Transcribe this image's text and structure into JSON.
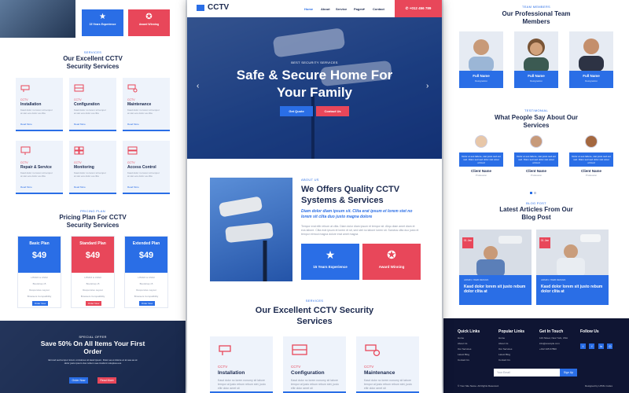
{
  "left": {
    "badges": [
      {
        "label": "15 Years Experience",
        "color": "#2a6ee6"
      },
      {
        "label": "Award Winning",
        "color": "#e8475a"
      }
    ],
    "services_kicker": "SERVICES",
    "services_title": "Our Excellent CCTV Security Services",
    "services": [
      {
        "kicker": "CCTV",
        "title": "Installation",
        "desc": "Kasd dolor no lorem sit tempor at stet eos dolor ea clita",
        "more": "Read More"
      },
      {
        "kicker": "CCTV",
        "title": "Configuration",
        "desc": "Kasd dolor no lorem sit tempor at stet eos dolor ea clita",
        "more": "Read More"
      },
      {
        "kicker": "CCTV",
        "title": "Maintenance",
        "desc": "Kasd dolor no lorem sit tempor at stet eos dolor ea clita",
        "more": "Read More"
      },
      {
        "kicker": "CCTV",
        "title": "Repair & Service",
        "desc": "Kasd dolor no lorem sit tempor at stet eos dolor ea clita",
        "more": "Read More"
      },
      {
        "kicker": "CCTV",
        "title": "Monitoring",
        "desc": "Kasd dolor no lorem sit tempor at stet eos dolor ea clita",
        "more": "Read More"
      },
      {
        "kicker": "CCTV",
        "title": "Access Control",
        "desc": "Kasd dolor no lorem sit tempor at stet eos dolor ea clita",
        "more": "Read More"
      }
    ],
    "pricing_kicker": "PRICING PLAN",
    "pricing_title": "Pricing Plan For CCTV Security Services",
    "plans": [
      {
        "name": "Basic Plan",
        "price": "49",
        "color": "#2a6ee6",
        "items": [
          "HTML5 & CSS3",
          "Bootstrap v5",
          "Responsive Layout",
          "Browsers Compatibility",
          "Easy to Use"
        ],
        "button": "Order Now"
      },
      {
        "name": "Standard Plan",
        "price": "49",
        "color": "#e8475a",
        "items": [
          "HTML5 & CSS3",
          "Bootstrap v5",
          "Responsive Layout",
          "Browsers Compatibility",
          "Easy to Use"
        ],
        "button": "Order Now"
      },
      {
        "name": "Extended Plan",
        "price": "49",
        "color": "#2a6ee6",
        "items": [
          "HTML5 & CSS3",
          "Bootstrap v5",
          "Responsive Layout",
          "Browsers Compatibility",
          "Easy to Use"
        ],
        "button": "Order Now"
      }
    ],
    "offer": {
      "kicker": "SPECIAL OFFER",
      "title": "Save 50% On All Items Your First Order",
      "text": "Eirmod sed tempor lorem ut dolores sit kasd ipsum. Dolor ea et dolore et at sea ea at dolor justo ipsum duo rebum sea invidunt voluptua eos",
      "btn1": "Order Now",
      "btn2": "Read More"
    }
  },
  "center": {
    "logo": "CCTV",
    "nav": [
      "Home",
      "About",
      "Service",
      "Pages",
      "Contact"
    ],
    "phone": "+012 456 789",
    "hero": {
      "kicker": "BEST SECURITY SERVICES",
      "title": "Safe & Secure Home For Your Family",
      "btn1": "Get Quote",
      "btn2": "Contact Us"
    },
    "about": {
      "kicker": "ABOUT US",
      "title": "We Offers Quality CCTV Systems & Services",
      "lead": "Diam dolor diam ipsum sit. Clita erat ipsum et lorem stet no lorem sit clita duo justo magna dolore",
      "body": "Tempor erat elitr rebum at clita. Diam dolor diam ipsum et tempor sit. Aliqu diam amet diam et eos labore. Clita erat ipsum et lorem et sit, sed stet no labore lorem sit. Sanctus clita duo justo et tempor eirmod magna dolore erat amet magna",
      "badge1": "15 Years Experience",
      "badge2": "Award Winning"
    },
    "services_kicker": "SERVICES",
    "services_title": "Our Excellent CCTV Security Services",
    "services": [
      {
        "kicker": "CCTV",
        "title": "Installation",
        "desc": "Kasd dolor no lorem nonumy sit labore tempor at justo rebum rebum stet, justo elitr dolor amet sit"
      },
      {
        "kicker": "CCTV",
        "title": "Configuration",
        "desc": "Kasd dolor no lorem nonumy sit labore tempor at justo rebum rebum stet, justo elitr dolor amet sit"
      },
      {
        "kicker": "CCTV",
        "title": "Maintenance",
        "desc": "Kasd dolor no lorem nonumy sit labore tempor at justo rebum rebum stet, justo elitr dolor amet sit"
      }
    ]
  },
  "right": {
    "team_kicker": "TEAM MEMBERS",
    "team_title": "Our Professional Team Members",
    "team": [
      {
        "name": "Full Name",
        "role": "Designation"
      },
      {
        "name": "Full Name",
        "role": "Designation"
      },
      {
        "name": "Full Name",
        "role": "Designation"
      }
    ],
    "testi_kicker": "TESTIMONIAL",
    "testi_title": "What People Say About Our Services",
    "testimonials": [
      {
        "quote": "Dolor et eos labore, stet justo sed est sed. Diam sed sed dolor stet amet eirmod",
        "name": "Client Name",
        "role": "Profession"
      },
      {
        "quote": "Dolor et eos labore, stet justo sed est sed. Diam sed sed dolor stet amet eirmod",
        "name": "Client Name",
        "role": "Profession"
      },
      {
        "quote": "Dolor et eos labore, stet justo sed est sed. Diam sed sed dolor stet amet eirmod",
        "name": "Client Name",
        "role": "Profession"
      }
    ],
    "blog_kicker": "BLOG POST",
    "blog_title": "Latest Articles From Our Blog Post",
    "posts": [
      {
        "date": "01 Jan",
        "meta": "ADMIN / WEB DESIGN",
        "title": "Kasd dolor lorem sit justo rebum dolor clita at"
      },
      {
        "date": "01 Jan",
        "meta": "ADMIN / WEB DESIGN",
        "title": "Kasd dolor lorem sit justo rebum dolor clita at"
      }
    ],
    "footer": {
      "quick_title": "Quick Links",
      "quick": [
        "Home",
        "About Us",
        "Our Services",
        "Latest Blog",
        "Contact Us"
      ],
      "popular_title": "Popular Links",
      "popular": [
        "Home",
        "About Us",
        "Our Services",
        "Latest Blog",
        "Contact Us"
      ],
      "touch_title": "Get In Touch",
      "touch": [
        "123 Street, New York, USA",
        "info@example.com",
        "+012 345 67890"
      ],
      "follow_title": "Follow Us",
      "email_placeholder": "Your Email",
      "signup": "Sign Up",
      "copyright": "© Your Site Name. All Rights Reserved.",
      "credit": "Designed by HTML Codex"
    }
  }
}
